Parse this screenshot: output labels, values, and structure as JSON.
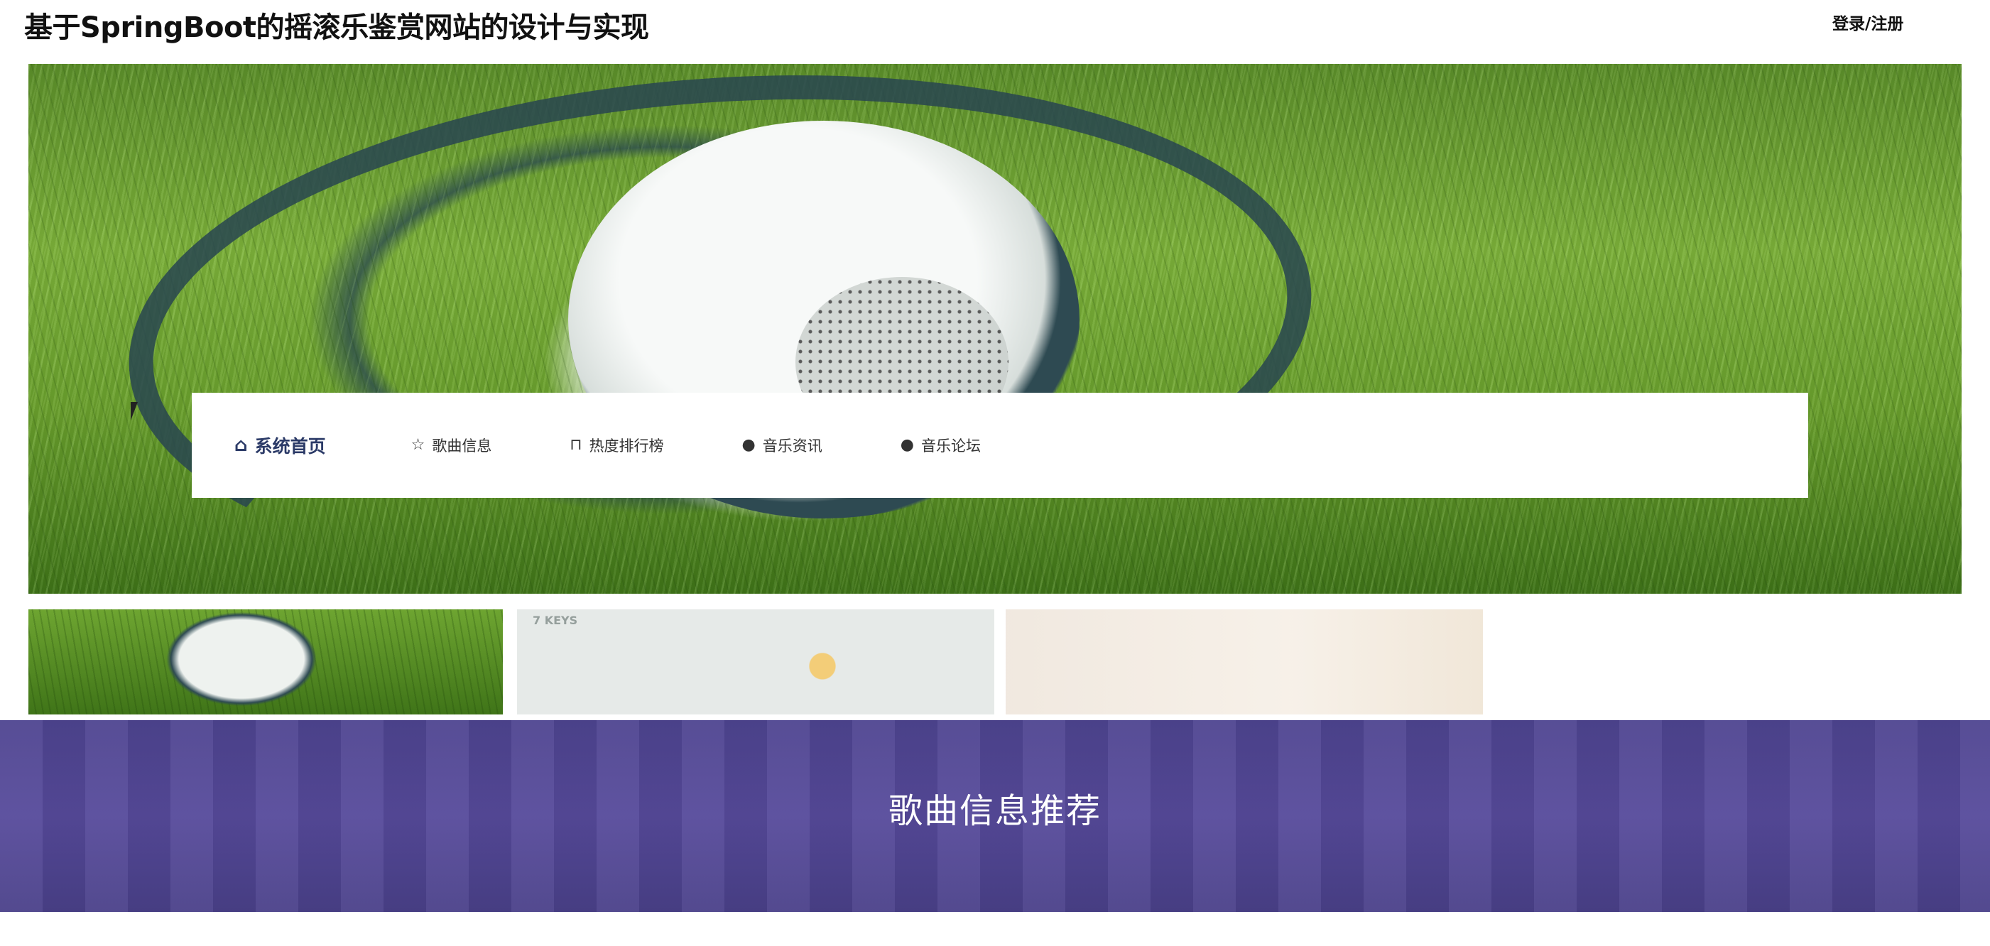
{
  "header": {
    "title": "基于SpringBoot的摇滚乐鉴赏网站的设计与实现",
    "login_label": "登录/注册"
  },
  "banner": {
    "next_icon": "chevron-right-icon"
  },
  "nav": {
    "items": [
      {
        "label": "系统首页",
        "icon": "home-icon",
        "active": true
      },
      {
        "label": "歌曲信息",
        "icon": "star-icon"
      },
      {
        "label": "热度排行榜",
        "icon": "bag-icon"
      },
      {
        "label": "音乐资讯",
        "icon": "exclamation-circle-icon"
      },
      {
        "label": "音乐论坛",
        "icon": "question-circle-icon"
      }
    ]
  },
  "thumbnails": {
    "thumb2_text": "7 KEYS"
  },
  "section": {
    "title": "歌曲信息推荐"
  },
  "colors": {
    "nav_active": "#2b3a67",
    "section_bg": "#524695"
  }
}
